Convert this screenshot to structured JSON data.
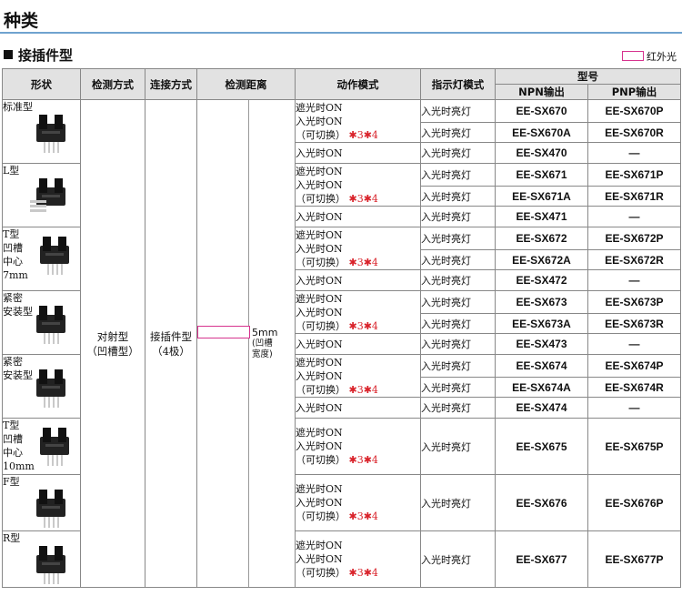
{
  "page_title": "种类",
  "section_title": "接插件型",
  "legend_label": "红外光",
  "headers": {
    "shape": "形状",
    "method": "检测方式",
    "connection": "连接方式",
    "distance": "检测距离",
    "operation": "动作模式",
    "indicator": "指示灯模式",
    "model": "型号",
    "npn": "NPN输出",
    "pnp": "PNP输出"
  },
  "method_text": [
    "对射型",
    "（凹槽型）"
  ],
  "connection_text": [
    "接插件型",
    "（4极）"
  ],
  "distance_text": {
    "value": "5mm",
    "note1": "(凹槽",
    "note2": "宽度)"
  },
  "operation": {
    "line1": "遮光时ON",
    "line2": "入光时ON",
    "line3": "（可切换）",
    "star3": "✱3",
    "star4": "✱4",
    "light_on": "入光时ON"
  },
  "indicator_text": "入光时亮灯",
  "shapes": [
    {
      "label_lines": [
        "标准型"
      ]
    },
    {
      "label_lines": [
        "L型"
      ]
    },
    {
      "label_lines": [
        "T型",
        "凹槽",
        "中心",
        "7mm"
      ]
    },
    {
      "label_lines": [
        "紧密",
        "安装型"
      ]
    },
    {
      "label_lines": [
        "紧密",
        "安装型"
      ]
    },
    {
      "label_lines": [
        "T型",
        "凹槽",
        "中心",
        "10mm"
      ]
    },
    {
      "label_lines": [
        "F型"
      ]
    },
    {
      "label_lines": [
        "R型"
      ]
    }
  ],
  "models": [
    {
      "npn": "EE-SX670",
      "pnp": "EE-SX670P"
    },
    {
      "npn": "EE-SX670A",
      "pnp": "EE-SX670R"
    },
    {
      "npn": "EE-SX470",
      "pnp": "—"
    },
    {
      "npn": "EE-SX671",
      "pnp": "EE-SX671P"
    },
    {
      "npn": "EE-SX671A",
      "pnp": "EE-SX671R"
    },
    {
      "npn": "EE-SX471",
      "pnp": "—"
    },
    {
      "npn": "EE-SX672",
      "pnp": "EE-SX672P"
    },
    {
      "npn": "EE-SX672A",
      "pnp": "EE-SX672R"
    },
    {
      "npn": "EE-SX472",
      "pnp": "—"
    },
    {
      "npn": "EE-SX673",
      "pnp": "EE-SX673P"
    },
    {
      "npn": "EE-SX673A",
      "pnp": "EE-SX673R"
    },
    {
      "npn": "EE-SX473",
      "pnp": "—"
    },
    {
      "npn": "EE-SX674",
      "pnp": "EE-SX674P"
    },
    {
      "npn": "EE-SX674A",
      "pnp": "EE-SX674R"
    },
    {
      "npn": "EE-SX474",
      "pnp": "—"
    },
    {
      "npn": "EE-SX675",
      "pnp": "EE-SX675P"
    },
    {
      "npn": "EE-SX676",
      "pnp": "EE-SX676P"
    },
    {
      "npn": "EE-SX677",
      "pnp": "EE-SX677P"
    }
  ],
  "colors": {
    "title_rule": "#6fa3cf",
    "infrared": "#d6338e",
    "star": "#d9222a",
    "header_bg": "#e2e2e2"
  }
}
